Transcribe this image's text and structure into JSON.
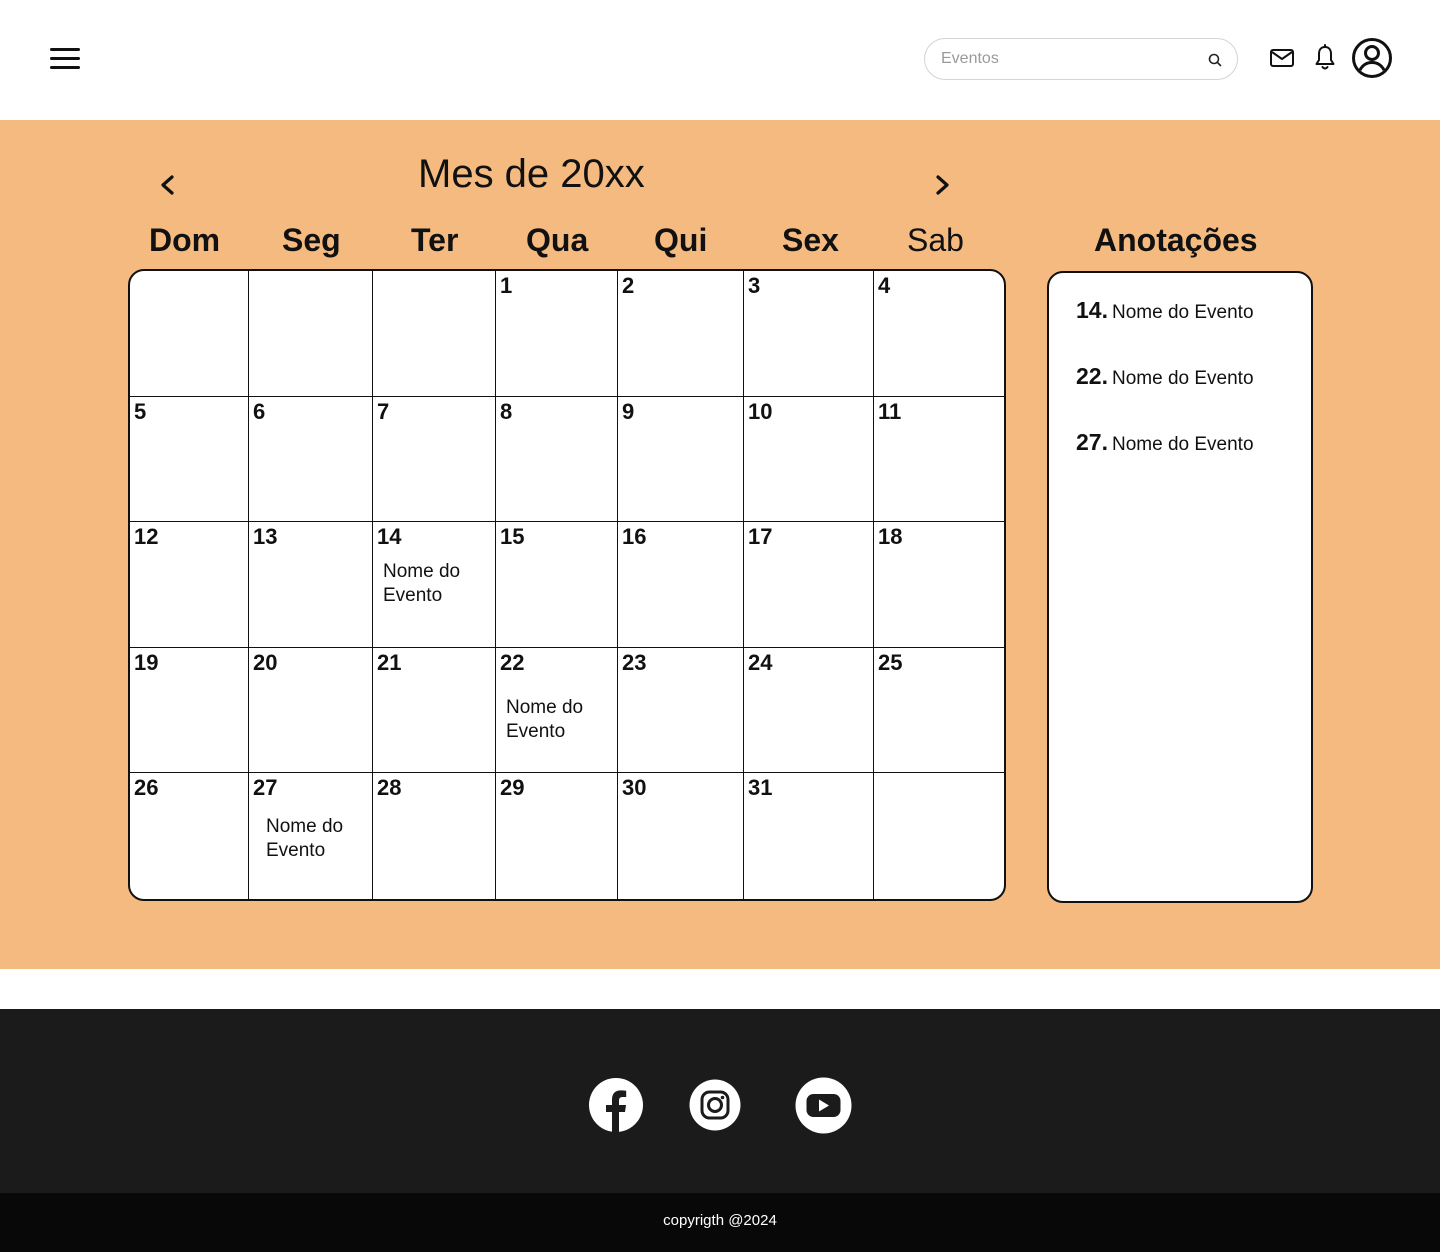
{
  "header": {
    "search": {
      "placeholder": "Eventos",
      "value": ""
    },
    "icons": [
      "menu-icon",
      "search-icon",
      "mail-icon",
      "bell-icon",
      "user-icon"
    ]
  },
  "calendar": {
    "title": "Mes de 20xx",
    "weekdays": [
      "Dom",
      "Seg",
      "Ter",
      "Qua",
      "Qui",
      "Sex",
      "Sab"
    ],
    "weeks": [
      [
        {
          "day": "",
          "event": ""
        },
        {
          "day": "",
          "event": ""
        },
        {
          "day": "",
          "event": ""
        },
        {
          "day": "1",
          "event": ""
        },
        {
          "day": "2",
          "event": ""
        },
        {
          "day": "3",
          "event": ""
        },
        {
          "day": "4",
          "event": ""
        }
      ],
      [
        {
          "day": "5",
          "event": ""
        },
        {
          "day": "6",
          "event": ""
        },
        {
          "day": "7",
          "event": ""
        },
        {
          "day": "8",
          "event": ""
        },
        {
          "day": "9",
          "event": ""
        },
        {
          "day": "10",
          "event": ""
        },
        {
          "day": "11",
          "event": ""
        }
      ],
      [
        {
          "day": "12",
          "event": ""
        },
        {
          "day": "13",
          "event": ""
        },
        {
          "day": "14",
          "event": "Nome do Evento"
        },
        {
          "day": "15",
          "event": ""
        },
        {
          "day": "16",
          "event": ""
        },
        {
          "day": "17",
          "event": ""
        },
        {
          "day": "18",
          "event": ""
        }
      ],
      [
        {
          "day": "19",
          "event": ""
        },
        {
          "day": "20",
          "event": ""
        },
        {
          "day": "21",
          "event": ""
        },
        {
          "day": "22",
          "event": "Nome do Evento"
        },
        {
          "day": "23",
          "event": ""
        },
        {
          "day": "24",
          "event": ""
        },
        {
          "day": "25",
          "event": ""
        }
      ],
      [
        {
          "day": "26",
          "event": ""
        },
        {
          "day": "27",
          "event": "Nome do Evento"
        },
        {
          "day": "28",
          "event": ""
        },
        {
          "day": "29",
          "event": ""
        },
        {
          "day": "30",
          "event": ""
        },
        {
          "day": "31",
          "event": ""
        },
        {
          "day": "",
          "event": ""
        }
      ]
    ]
  },
  "notes": {
    "title": "Anotações",
    "items": [
      {
        "day": "14.",
        "text": "Nome do Evento"
      },
      {
        "day": "22.",
        "text": "Nome do Evento"
      },
      {
        "day": "27.",
        "text": "Nome do Evento"
      }
    ]
  },
  "footer": {
    "social": [
      "facebook-icon",
      "instagram-icon",
      "youtube-icon"
    ],
    "copyright": "copyrigth @2024"
  },
  "colors": {
    "accent": "#f5ba7f",
    "footer": "#1b1b1b",
    "copyright_bar": "#080808"
  }
}
